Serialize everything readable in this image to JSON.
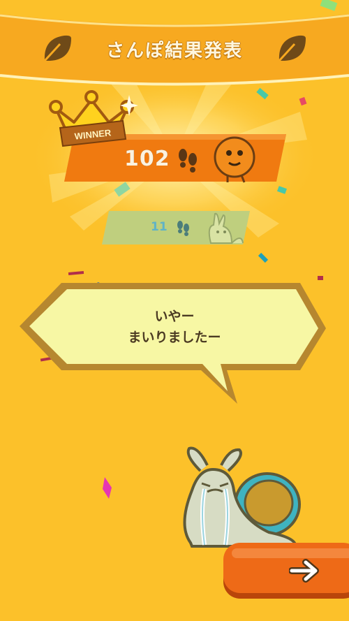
{
  "header": {
    "title": "さんぽ結果発表"
  },
  "winner": {
    "badge": "WINNER",
    "steps": "102",
    "character": "orange-blob"
  },
  "loser": {
    "steps": "11",
    "character": "rabbit"
  },
  "speech": {
    "line1": "いやー",
    "line2": "まいりましたー"
  },
  "mascot": {
    "name": "crying-snail"
  },
  "next_button": {
    "icon": "arrow-right-icon"
  },
  "colors": {
    "background": "#fcc12a",
    "banner": "#f7a920",
    "winner_bar": "#f07a10",
    "loser_bar": "#bfcf7e",
    "speech_fill": "#f7f7a4",
    "speech_border": "#a57b2e",
    "button": "#ee6a17"
  }
}
